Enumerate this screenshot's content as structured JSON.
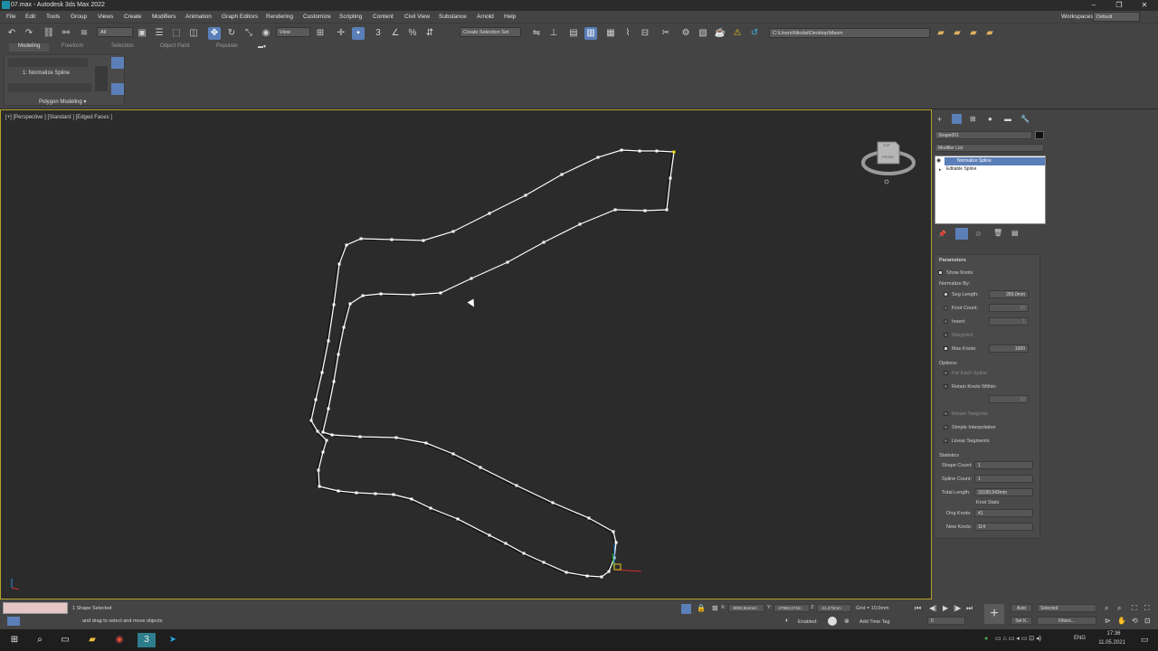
{
  "window": {
    "title": "07.max - Autodesk 3ds Max 2022"
  },
  "menu": [
    "File",
    "Edit",
    "Tools",
    "Group",
    "Views",
    "Create",
    "Modifiers",
    "Animation",
    "Graph Editors",
    "Rendering",
    "Customize",
    "Scripting",
    "Content",
    "Civil View",
    "Substance",
    "Arnold",
    "Help"
  ],
  "workspace": {
    "label": "Workspaces:",
    "value": "Default"
  },
  "toolbar": {
    "filter": "All",
    "refcoord": "View",
    "selection_set": "Create Selection Set",
    "path": "C:\\Users\\Nikolai\\Desktop\\Maxm"
  },
  "ribbon": {
    "tabs": [
      "Modeling",
      "Freeform",
      "Selection",
      "Object Paint",
      "Populate"
    ],
    "active_tab": "Modeling",
    "panel_item": "1: Normalize Spline",
    "panel_title": "Polygon Modeling ▾"
  },
  "viewport": {
    "label": "[+] [Perspective ] [Standard ] [Edged Faces ]",
    "viewcube_top": "TOP",
    "viewcube_front": "FRONT"
  },
  "cmd": {
    "object_name": "Shape001",
    "modifier_list": "Modifier List",
    "stack": [
      {
        "label": "Normalize Spline",
        "selected": true
      },
      {
        "label": "Editable Spline",
        "selected": false
      }
    ],
    "rollout_title": "Parameters",
    "show_knots": "Show Knots",
    "normalize_by": "Normalize By:",
    "seg_length_label": "Seg Length:",
    "seg_length": "289,0mm",
    "knot_count_label": "Knot Count:",
    "knot_count": "20",
    "insert_label": "Insert:",
    "insert": "1",
    "weighted": "Weighted",
    "max_knots_label": "Max Knots:",
    "max_knots": "1000",
    "options": "Options:",
    "for_each_spline": "For Each Spline",
    "retain_knots_within": "Retain Knots Within:",
    "retain_value": "10",
    "retain_tangents": "Retain Tangents",
    "simple_interpolation": "Simple Interpolation",
    "linear_segments": "Linear Segments",
    "statistics": "Statistics",
    "shape_count_label": "Shape Count:",
    "shape_count": "1",
    "spline_count_label": "Spline Count:",
    "spline_count": "1",
    "total_length_label": "Total Length:",
    "total_length": "33180,943mm",
    "knot_stats": "Knot Stats",
    "orig_knots_label": "Orig Knots:",
    "orig_knots": "41",
    "new_knots_label": "New Knots:",
    "new_knots": "114"
  },
  "status": {
    "selected": "1 Shape Selected",
    "prompt": "and drag to select and move objects",
    "x_label": "X:",
    "x": "-9000,554mm",
    "y_label": "Y:",
    "y": "-47983,074m",
    "z_label": "Z:",
    "z": "-41,273mm",
    "grid": "Grid = 10,0mm",
    "enabled": "Enabled:",
    "add_time_tag": "Add Time Tag",
    "auto": "Auto",
    "set_k": "Set K.",
    "selected_combo": "Selected",
    "filters": "Filters...",
    "frame": "0"
  },
  "taskbar": {
    "lang": "ENG",
    "time": "17:36",
    "date": "11.05.2021"
  },
  "colors": {
    "accent": "#5b7fb8",
    "viewport_border": "#b5a229",
    "spline": "#ffffff",
    "vertex_end": "#e8e000"
  }
}
